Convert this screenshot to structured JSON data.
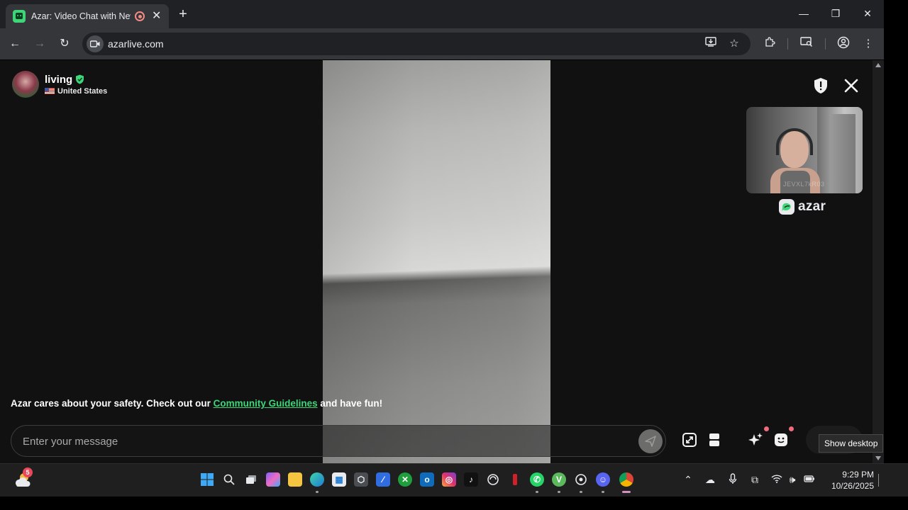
{
  "browser": {
    "tab_title": "Azar: Video Chat with New",
    "new_tab_label": "+",
    "tab_close_label": "✕",
    "url": "azarlive.com",
    "window": {
      "minimize": "—",
      "maximize": "❐",
      "close": "✕"
    }
  },
  "profile": {
    "username": "living",
    "country": "United States"
  },
  "selfview": {
    "watermark": "JEVXL7kR03",
    "brand": "azar"
  },
  "safety": {
    "prefix": "Azar cares about your safety. Check out our ",
    "link": "Community Guidelines",
    "suffix": " and have fun!"
  },
  "message": {
    "placeholder": "Enter your message"
  },
  "tooltip": {
    "text": "Show desktop"
  },
  "taskbar": {
    "weather_badge": "5",
    "time": "9:29 PM",
    "date": "10/26/2025"
  },
  "colors": {
    "accent": "#3fd67a",
    "notification_dot": "#f06b7c",
    "page_bg": "#111111"
  }
}
